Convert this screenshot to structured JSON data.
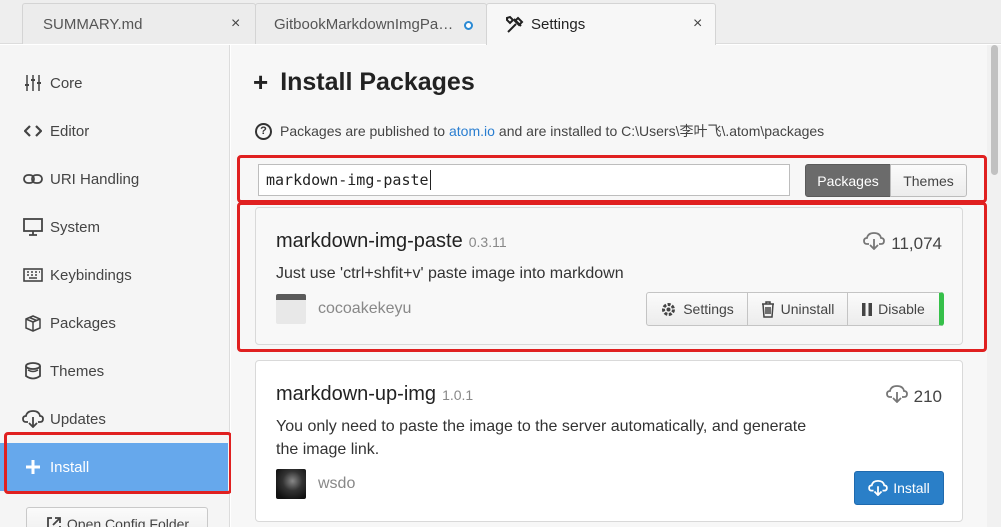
{
  "tabs": [
    {
      "title": "SUMMARY.md",
      "close": "×"
    },
    {
      "title": "GitbookMarkdownImgPas…",
      "modified": true
    },
    {
      "title": "Settings",
      "close": "×",
      "icon": "tools-icon"
    }
  ],
  "sidebar": {
    "items": [
      {
        "label": "Core",
        "icon": "sliders-icon"
      },
      {
        "label": "Editor",
        "icon": "code-icon"
      },
      {
        "label": "URI Handling",
        "icon": "link-icon"
      },
      {
        "label": "System",
        "icon": "monitor-icon"
      },
      {
        "label": "Keybindings",
        "icon": "keyboard-icon"
      },
      {
        "label": "Packages",
        "icon": "package-icon"
      },
      {
        "label": "Themes",
        "icon": "paintcan-icon"
      },
      {
        "label": "Updates",
        "icon": "cloud-download-icon"
      },
      {
        "label": "Install",
        "icon": "plus-icon",
        "active": true
      }
    ],
    "config_button": "Open Config Folder"
  },
  "main": {
    "title": "Install Packages",
    "title_icon": "+",
    "info_prefix": "Packages are published to",
    "info_link": "atom.io",
    "info_suffix": "and are installed to C:\\Users\\李叶飞\\.atom\\packages",
    "search": {
      "value": "markdown-img-paste"
    },
    "toggle": {
      "packages": "Packages",
      "themes": "Themes",
      "selected": "Packages"
    }
  },
  "packages": [
    {
      "name": "markdown-img-paste",
      "version": "0.3.11",
      "downloads": "11,074",
      "description": "Just use 'ctrl+shfit+v' paste image into markdown",
      "author": "cocoakekeyu",
      "buttons": {
        "settings": "Settings",
        "uninstall": "Uninstall",
        "disable": "Disable"
      }
    },
    {
      "name": "markdown-up-img",
      "version": "1.0.1",
      "downloads": "210",
      "description": "You only need to paste the image to the server automatically, and generate the image link.",
      "author": "wsdo",
      "buttons": {
        "install": "Install"
      }
    }
  ],
  "colors": {
    "accent": "#66a8ec",
    "highlight": "#e02020",
    "install": "#2a7fc8",
    "enabled": "#36c04a"
  }
}
